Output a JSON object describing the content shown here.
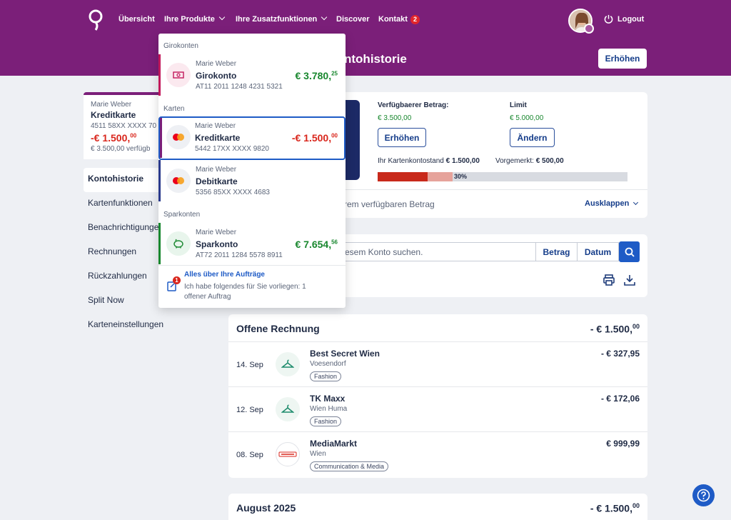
{
  "nav": {
    "items": [
      "Übersicht",
      "Ihre Produkte",
      "Ihre Zusatzfunktionen",
      "Discover",
      "Kontakt"
    ],
    "contact_badge": "2",
    "logout": "Logout"
  },
  "hero": {
    "title": "Kontohistorie",
    "title_visible": "ntohistorie",
    "button": "Erhöhen"
  },
  "left_card": {
    "owner": "Marie Weber",
    "title": "Kreditkarte",
    "number": "4511 58XX XXXX 70",
    "amount": "-€ 1.500,",
    "amount_cents": "00",
    "available": "€ 3.500,00 verfügb"
  },
  "menu": [
    "Kontohistorie",
    "Kartenfunktionen",
    "Benachrichtigungen",
    "Rechnungen",
    "Rückzahlungen",
    "Split Now",
    "Karteneinstellungen"
  ],
  "limit": {
    "available_label": "Verfügbaerer Betrag:",
    "available_value": "€ 3.500,00",
    "limit_label": "Limit",
    "limit_value": "€ 5.000,00",
    "btn_raise": "Erhöhen",
    "btn_change": "Ändern",
    "balance_label": "Ihr Kartenkontostand",
    "balance_value": "€ 1.500,00",
    "reserved_label": "Vorgemerkt:",
    "reserved_value": "€ 500,00",
    "progress_booked": 0.2,
    "progress_reserved": 0.3,
    "progress_label": "30%",
    "footer_text": "rem verfügbaren Betrag",
    "expand": "Ausklappen"
  },
  "search": {
    "placeholder": "esem Konto suchen.",
    "btn_amount": "Betrag",
    "btn_date": "Datum"
  },
  "open_invoice": {
    "title": "Offene Rechnung",
    "total": "- € 1.500,",
    "total_cents": "00",
    "rows": [
      {
        "date": "14. Sep",
        "name": "Best Secret Wien",
        "location": "Voesendorf",
        "tag": "Fashion",
        "amount": "- € 327,95"
      },
      {
        "date": "12. Sep",
        "name": "TK Maxx",
        "location": "Wien Huma",
        "tag": "Fashion",
        "amount": "- € 172,06"
      },
      {
        "date": "08. Sep",
        "name": "MediaMarkt",
        "location": "Wien",
        "tag": "Communication & Media",
        "amount": "€ 999,99"
      }
    ]
  },
  "august": {
    "title": "August 2025",
    "total": "- € 1.500,",
    "total_cents": "00"
  },
  "dropdown": {
    "sections": [
      "Girokonten",
      "Karten",
      "Sparkonten"
    ],
    "items": [
      {
        "owner": "Marie Weber",
        "name": "Girokonto",
        "number": "AT11 2011 1248 4231 5321",
        "amount": "€ 3.780,",
        "cents": "25",
        "color": "#18872e",
        "accent": "#c2185b"
      },
      {
        "owner": "Marie Weber",
        "name": "Kreditkarte",
        "number": "5442 17XX XXXX 9820",
        "amount": "-€ 1.500,",
        "cents": "00",
        "color": "#d9261c",
        "accent": "#7b1f79"
      },
      {
        "owner": "Marie Weber",
        "name": "Debitkarte",
        "number": "5356 85XX XXXX 4683",
        "amount": "",
        "cents": "",
        "color": "#1f2a44",
        "accent": "#2a3a8c"
      },
      {
        "owner": "Marie Weber",
        "name": "Sparkonto",
        "number": "AT72 2011 1284 5578 8911",
        "amount": "€ 7.654,",
        "cents": "56",
        "color": "#18872e",
        "accent": "#18872e"
      }
    ],
    "orders_title": "Alles über Ihre Aufträge",
    "orders_text": "Ich habe folgendes für Sie vorliegen: 1 offener Auftrag",
    "orders_badge": "1"
  },
  "colors": {
    "brand": "#7b1f79",
    "primary": "#1e5bc6",
    "positive": "#18872e",
    "negative": "#d9261c"
  },
  "icons": [
    "logo-icon",
    "chevron-down-icon",
    "power-icon",
    "banknote-icon",
    "mastercard-icon",
    "piggy-bank-icon",
    "search-icon",
    "printer-icon",
    "download-icon",
    "hanger-icon",
    "orders-icon",
    "help-icon"
  ]
}
